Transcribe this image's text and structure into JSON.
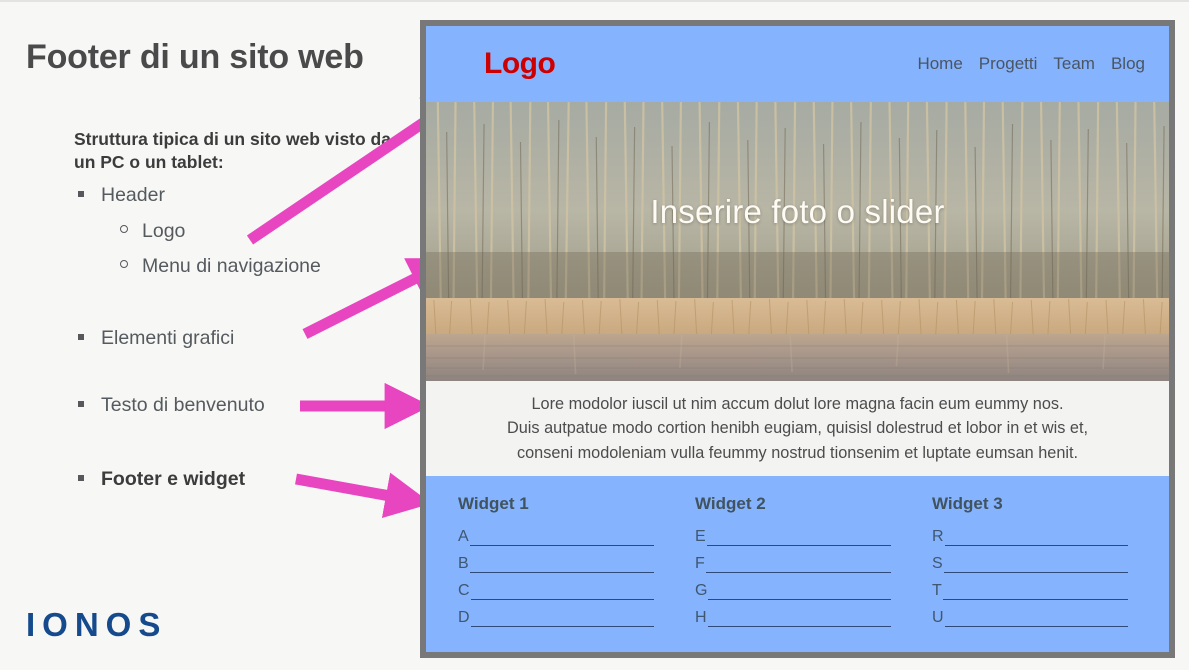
{
  "slide": {
    "title": "Footer di un sito web",
    "intro_heading": "Struttura tipica di un sito web visto da un PC o un tablet:",
    "brand_logo": "IONOS",
    "brand_color": "#154a8c",
    "accent_arrow_color": "#e845c0",
    "background_color": "#f7f7f6"
  },
  "outline": [
    {
      "level": 1,
      "label": "Header",
      "bold": false
    },
    {
      "level": 2,
      "label": "Logo",
      "bold": false
    },
    {
      "level": 2,
      "label": "Menu di navigazione",
      "bold": false
    },
    {
      "level": 1,
      "label": "Elementi grafici",
      "bold": false
    },
    {
      "level": 1,
      "label": "Testo di benvenuto",
      "bold": false
    },
    {
      "level": 1,
      "label": "Footer e widget",
      "bold": true
    }
  ],
  "mockup": {
    "frame_color": "#787878",
    "header": {
      "background": "#85b3fd",
      "logo": "Logo",
      "logo_color": "#cc0000",
      "nav": [
        "Home",
        "Progetti",
        "Team",
        "Blog"
      ]
    },
    "hero": {
      "caption": "Inserire foto o slider",
      "caption_color": "#fdfbf4",
      "image_description": "winter-woodland-pond-photo"
    },
    "welcome": {
      "background": "#f3f3f2",
      "lines": [
        "Lore modolor iuscil ut nim accum dolut lore magna facin eum eummy nos.",
        "Duis autpatue modo cortion henibh eugiam, quisisl dolestrud et lobor in et wis et,",
        "conseni modoleniam vulla feummy nostrud tionsenim et luptate eumsan henit."
      ]
    },
    "footer": {
      "background": "#85b3fd",
      "widgets": [
        {
          "title": "Widget 1",
          "items": [
            "A",
            "B",
            "C",
            "D"
          ]
        },
        {
          "title": "Widget 2",
          "items": [
            "E",
            "F",
            "G",
            "H"
          ]
        },
        {
          "title": "Widget 3",
          "items": [
            "R",
            "S",
            "T",
            "U"
          ]
        }
      ]
    }
  }
}
